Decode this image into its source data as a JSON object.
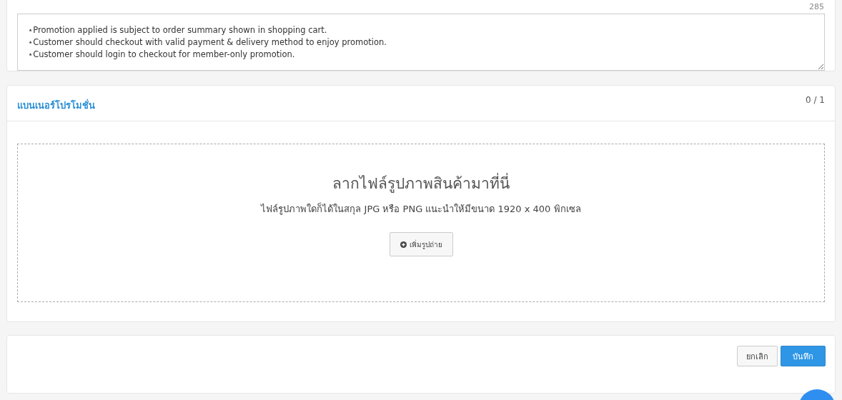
{
  "terms": {
    "counter": "285",
    "value": "⋆Promotion applied is subject to order summary shown in shopping cart.\n⋆Customer should checkout with valid payment & delivery method to enjoy promotion.\n⋆Customer should login to checkout for member-only promotion."
  },
  "banner": {
    "title": "แบนเนอร์โปรโมชั่น",
    "count": "0 / 1",
    "drop_title": "ลากไฟล์รูปภาพสินค้ามาที่นี่",
    "drop_hint": "ไฟล์รูปภาพใดก็ได้ในสกุล JPG หรือ PNG แนะนำให้มีขนาด 1920 x 400 พิกเซล",
    "add_button": "เพิ่มรูปถ่าย"
  },
  "actions": [
    {
      "label": "ยกเลิก",
      "kind": "secondary"
    },
    {
      "label": "บันทึก",
      "kind": "primary"
    }
  ]
}
